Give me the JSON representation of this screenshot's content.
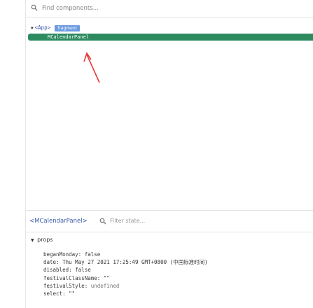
{
  "search": {
    "placeholder": "Find components..."
  },
  "tree": {
    "root_label": "<App>",
    "root_badge": "fragment",
    "selected_label": "MCalendarPanel"
  },
  "inspector": {
    "component_name": "<MCalendarPanel>",
    "filter_placeholder": "Filter state..."
  },
  "props": {
    "title": "props",
    "items": [
      {
        "key": "beganMonday",
        "sep": ": ",
        "value": "false"
      },
      {
        "key": "date",
        "sep": ": ",
        "value": "Thu May 27 2021 17:25:49 GMT+0800 (中国标准时间)"
      },
      {
        "key": "disabled",
        "sep": ": ",
        "value": "false"
      },
      {
        "key": "festivalClassName",
        "sep": ": ",
        "value": "\"\""
      },
      {
        "key": "festivalStyle",
        "sep": ": ",
        "value": "undefined"
      },
      {
        "key": "select",
        "sep": ": ",
        "value": "\"\""
      }
    ]
  },
  "colors": {
    "selected_row": "#2e8b60",
    "badge": "#6d9be0",
    "arrow": "#e53935",
    "component_tag": "#3c5ba9"
  },
  "icons": [
    "search-icon",
    "filter-icon",
    "caret-down-icon",
    "annotation-arrow"
  ]
}
